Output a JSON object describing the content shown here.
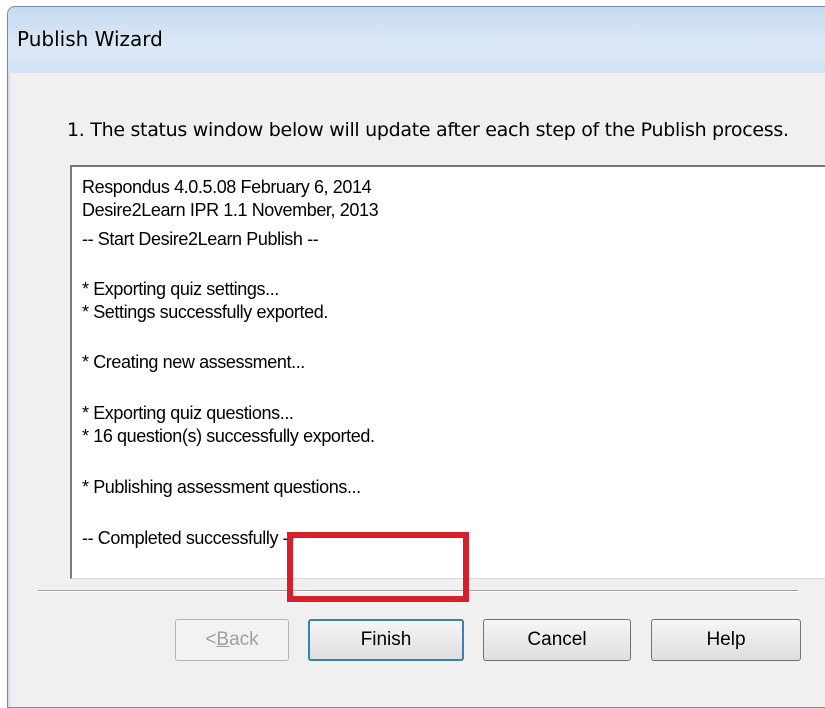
{
  "window": {
    "title": "Publish Wizard"
  },
  "step": {
    "instruction": "1.  The status window below will update after each step of the Publish process."
  },
  "status_log": [
    "Respondus 4.0.5.08  February 6, 2014",
    "Desire2Learn IPR 1.1   November, 2013",
    "-- Start Desire2Learn Publish --",
    "* Exporting quiz settings...",
    "* Settings successfully exported.",
    "* Creating new assessment...",
    "* Exporting quiz questions...",
    "* 16 question(s) successfully exported.",
    "* Publishing assessment questions...",
    "-- Completed successfully --"
  ],
  "buttons": {
    "back": {
      "prefix": "< ",
      "accel": "B",
      "rest": "ack"
    },
    "finish": "Finish",
    "cancel": "Cancel",
    "help": "Help"
  },
  "annotation": {
    "highlight_color": "#d4202a"
  }
}
